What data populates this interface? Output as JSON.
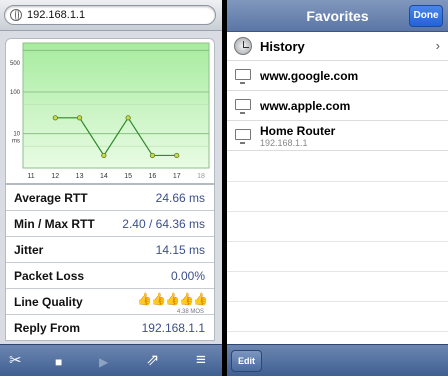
{
  "left": {
    "url": "192.168.1.1",
    "chart_data": {
      "type": "line",
      "x": [
        12,
        13,
        14,
        15,
        16,
        17
      ],
      "values": [
        24,
        24,
        3,
        24,
        3,
        3
      ],
      "x_ticks": [
        "11",
        "12",
        "13",
        "14",
        "15",
        "16",
        "17",
        "18"
      ],
      "y_ticks": [
        "500",
        "100",
        "10"
      ],
      "y_unit": "ms",
      "scale": "log",
      "grid": true,
      "fill_color": "#9de39a",
      "line_color": "#2f8a2a",
      "point_color": "#c9d94a"
    },
    "stats": [
      {
        "label": "Average RTT",
        "value": "24.66 ms"
      },
      {
        "label": "Min / Max RTT",
        "value": "2.40 / 64.36 ms"
      },
      {
        "label": "Jitter",
        "value": "14.15 ms"
      },
      {
        "label": "Packet Loss",
        "value": "0.00%"
      },
      {
        "label": "Line Quality",
        "value": "",
        "mos": "4.38 MOS",
        "thumbs": 5
      },
      {
        "label": "Reply From",
        "value": "192.168.1.1"
      }
    ],
    "toolbar": {
      "tools_icon": "✂",
      "stop_icon": "■",
      "play_icon": "▶",
      "share_icon": "⇗",
      "list_icon": "≡"
    }
  },
  "right": {
    "title": "Favorites",
    "done_label": "Done",
    "edit_label": "Edit",
    "items": [
      {
        "label": "History",
        "type": "history"
      },
      {
        "label": "www.google.com",
        "type": "site"
      },
      {
        "label": "www.apple.com",
        "type": "site"
      },
      {
        "label": "Home Router",
        "sub": "192.168.1.1",
        "type": "site"
      }
    ]
  }
}
